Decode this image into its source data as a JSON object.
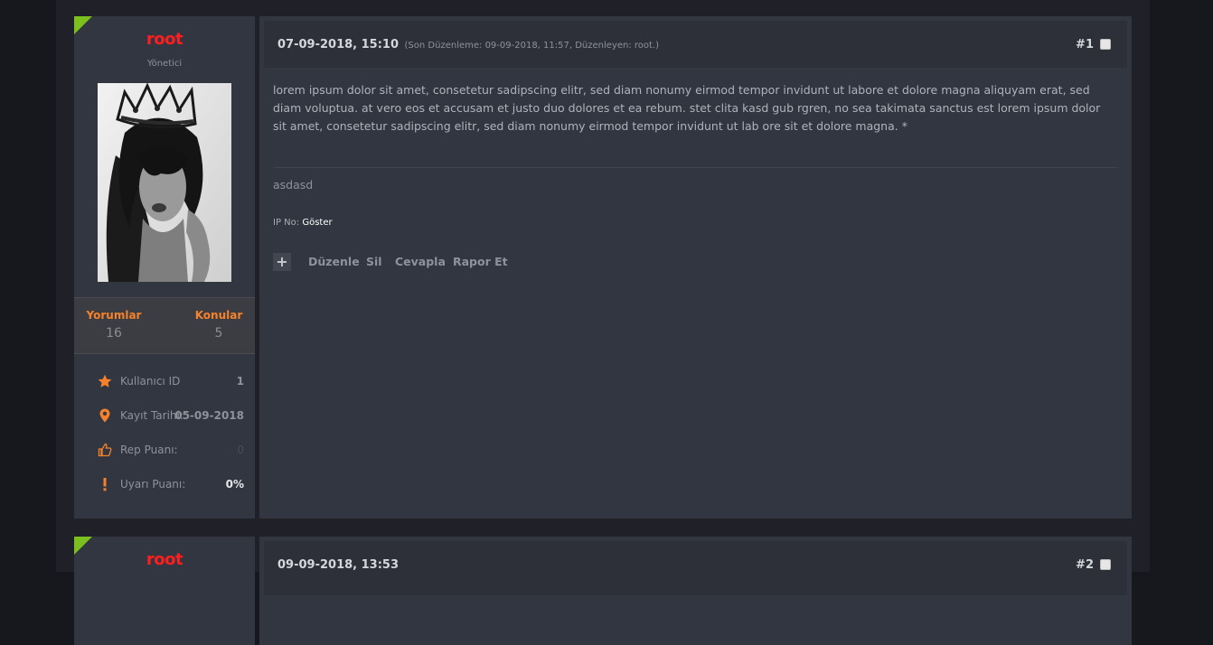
{
  "posts": [
    {
      "username": "root",
      "usertitle": "Yönetici",
      "stats": {
        "comments_label": "Yorumlar",
        "comments_value": "16",
        "topics_label": "Konular",
        "topics_value": "5"
      },
      "details": [
        {
          "icon": "star-icon",
          "label": "Kullanıcı ID",
          "value": "1"
        },
        {
          "icon": "map-pin-icon",
          "label": "Kayıt Tarihi:",
          "value": "05-09-2018"
        },
        {
          "icon": "thumbs-up-icon",
          "label": "Rep Puanı:",
          "value": "0"
        },
        {
          "icon": "exclamation-icon",
          "label": "Uyarı Puanı:",
          "value": "0%"
        }
      ],
      "date": "07-09-2018, 15:10",
      "edited": "(Son Düzenleme: 09-09-2018, 11:57, Düzenleyen: root.)",
      "post_number": "#1",
      "message": "lorem ipsum dolor sit amet, consetetur sadipscing elitr, sed diam nonumy eirmod tempor invidunt ut labore et dolore magna aliquyam erat, sed diam voluptua. at vero eos et accusam et justo duo dolores et ea rebum. stet clita kasd gub rgren, no sea takimata sanctus est lorem ipsum dolor sit amet, consetetur sadipscing elitr, sed diam nonumy eirmod tempor invidunt ut lab ore sit et dolore magna. *",
      "signature": "asdasd",
      "ip_label": "IP No:",
      "ip_action": "Göster",
      "actions": {
        "plus": "+",
        "edit": "Düzenle",
        "delete": "Sil",
        "reply": "Cevapla",
        "report": "Rapor Et"
      }
    },
    {
      "username": "root",
      "date": "09-09-2018, 13:53",
      "post_number": "#2"
    }
  ],
  "colors": {
    "accent": "#f5822b",
    "username": "#ff1e1e",
    "corner_badge": "#7dbf1e",
    "panel": "#323641",
    "background": "#17181d"
  }
}
